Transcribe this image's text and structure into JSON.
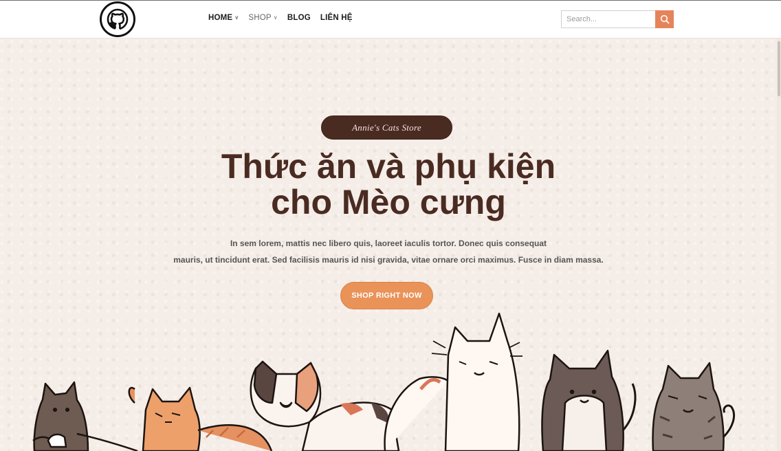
{
  "header": {
    "logo_icon": "github-cat-icon",
    "nav": [
      {
        "label": "HOME",
        "has_dropdown": true,
        "icon": "chevron-down-icon"
      },
      {
        "label": "SHOP",
        "has_dropdown": true,
        "icon": "chevron-down-icon"
      },
      {
        "label": "BLOG",
        "has_dropdown": false
      },
      {
        "label": "LIÊN HỆ",
        "has_dropdown": false
      }
    ],
    "search": {
      "placeholder": "Search...",
      "value": "",
      "button_icon": "search-icon"
    }
  },
  "hero": {
    "badge": "Annie's Cats Store",
    "headline_line1": "Thức ăn và phụ kiện",
    "headline_line2": "cho Mèo cưng",
    "sub_line1": "In sem lorem, mattis nec libero quis, laoreet iaculis tortor. Donec quis consequat",
    "sub_line2": "mauris, ut tincidunt erat. Sed facilisis mauris id nisi gravida, vitae ornare orci maximus. Fusce in diam massa.",
    "cta_label": "SHOP RIGHT NOW",
    "illustration": "cats-illustration"
  },
  "colors": {
    "accent": "#e5845a",
    "cta": "#e99359",
    "brown": "#4a2b22",
    "background": "#f5ede7"
  }
}
